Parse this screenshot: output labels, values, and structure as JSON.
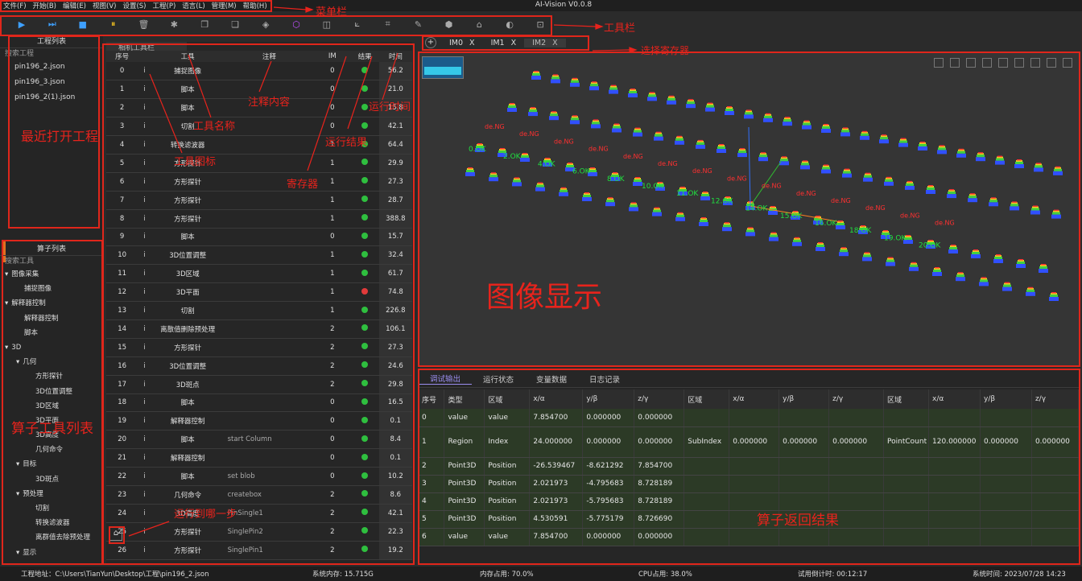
{
  "menu": {
    "items": [
      "文件(F)",
      "开始(B)",
      "编辑(E)",
      "视图(V)",
      "设置(S)",
      "工程(P)",
      "语言(L)",
      "管理(M)",
      "帮助(H)"
    ]
  },
  "app_title": "AI-Vision V0.0.8",
  "toolbar": {
    "icons": [
      {
        "name": "run-icon",
        "glyph": "▶",
        "tone": "blue"
      },
      {
        "name": "run-loop-icon",
        "glyph": "⏭",
        "tone": "blue"
      },
      {
        "name": "save-icon",
        "glyph": "■",
        "tone": "blue"
      },
      {
        "name": "pause-icon",
        "glyph": "⏸",
        "tone": "yellow"
      },
      {
        "name": "delete-icon",
        "glyph": "🗑",
        "tone": "gray"
      },
      {
        "name": "debug-icon",
        "glyph": "✱",
        "tone": "gray"
      },
      {
        "name": "copy-icon",
        "glyph": "❐",
        "tone": "gray"
      },
      {
        "name": "paste-icon",
        "glyph": "❏",
        "tone": "gray"
      },
      {
        "name": "cube-icon",
        "glyph": "◈",
        "tone": "gray"
      },
      {
        "name": "3d-view-icon",
        "glyph": "⬡",
        "tone": "purple"
      },
      {
        "name": "camera-icon",
        "glyph": "◫",
        "tone": "gray"
      },
      {
        "name": "measure-icon",
        "glyph": "⟀",
        "tone": "gray"
      },
      {
        "name": "crop-icon",
        "glyph": "⌗",
        "tone": "gray"
      },
      {
        "name": "brush-icon",
        "glyph": "✎",
        "tone": "gray"
      },
      {
        "name": "box-icon",
        "glyph": "⬢",
        "tone": "gray"
      },
      {
        "name": "home-icon",
        "glyph": "⌂",
        "tone": "gray"
      },
      {
        "name": "chart-icon",
        "glyph": "◐",
        "tone": "gray"
      },
      {
        "name": "focus-icon",
        "glyph": "⊡",
        "tone": "gray"
      }
    ]
  },
  "project_panel": {
    "title": "工程列表",
    "search": "搜索工程",
    "recent": [
      "pin196_2.json",
      "pin196_3.json",
      "pin196_2(1).json"
    ]
  },
  "algo_panel": {
    "title": "算子列表",
    "search": "搜索工具",
    "tree": [
      {
        "label": "图像采集",
        "level": 0,
        "arrow": "▾"
      },
      {
        "label": "捕捉图像",
        "level": 1,
        "arrow": ""
      },
      {
        "label": "解释器控制",
        "level": 0,
        "arrow": "▾"
      },
      {
        "label": "解释器控制",
        "level": 1,
        "arrow": ""
      },
      {
        "label": "脚本",
        "level": 1,
        "arrow": ""
      },
      {
        "label": "3D",
        "level": 0,
        "arrow": "▾"
      },
      {
        "label": "几何",
        "level": 1,
        "arrow": "▾"
      },
      {
        "label": "方形探针",
        "level": 2,
        "arrow": ""
      },
      {
        "label": "3D位置调整",
        "level": 2,
        "arrow": ""
      },
      {
        "label": "3D区域",
        "level": 2,
        "arrow": ""
      },
      {
        "label": "3D平面",
        "level": 2,
        "arrow": ""
      },
      {
        "label": "3D高度",
        "level": 2,
        "arrow": ""
      },
      {
        "label": "几何命令",
        "level": 2,
        "arrow": ""
      },
      {
        "label": "目标",
        "level": 1,
        "arrow": "▾"
      },
      {
        "label": "3D斑点",
        "level": 2,
        "arrow": ""
      },
      {
        "label": "预处理",
        "level": 1,
        "arrow": "▾"
      },
      {
        "label": "切割",
        "level": 2,
        "arrow": ""
      },
      {
        "label": "转换滤波器",
        "level": 2,
        "arrow": ""
      },
      {
        "label": "离群值去除预处理",
        "level": 2,
        "arrow": ""
      },
      {
        "label": "显示",
        "level": 1,
        "arrow": "▾"
      }
    ]
  },
  "tool_panel": {
    "tab": "相机工具栏",
    "headers": [
      "序号",
      "工具",
      "注释",
      "IM",
      "结果",
      "时间"
    ],
    "rows": [
      {
        "id": "0",
        "tool": "捕捉图像",
        "note": "",
        "im": "0",
        "result": "ok",
        "time": "56.2"
      },
      {
        "id": "1",
        "tool": "脚本",
        "note": "",
        "im": "0",
        "result": "ok",
        "time": "21.0"
      },
      {
        "id": "2",
        "tool": "脚本",
        "note": "",
        "im": "0",
        "result": "ok",
        "time": "15.8"
      },
      {
        "id": "3",
        "tool": "切割",
        "note": "",
        "im": "0",
        "result": "ok",
        "time": "42.1"
      },
      {
        "id": "4",
        "tool": "转换滤波器",
        "note": "",
        "im": "1",
        "result": "ok",
        "time": "64.4"
      },
      {
        "id": "5",
        "tool": "方形探针",
        "note": "",
        "im": "1",
        "result": "ok",
        "time": "29.9"
      },
      {
        "id": "6",
        "tool": "方形探针",
        "note": "",
        "im": "1",
        "result": "ok",
        "time": "27.3"
      },
      {
        "id": "7",
        "tool": "方形探针",
        "note": "",
        "im": "1",
        "result": "ok",
        "time": "28.7"
      },
      {
        "id": "8",
        "tool": "方形探针",
        "note": "",
        "im": "1",
        "result": "ok",
        "time": "388.8"
      },
      {
        "id": "9",
        "tool": "脚本",
        "note": "",
        "im": "0",
        "result": "ok",
        "time": "15.7"
      },
      {
        "id": "10",
        "tool": "3D位置调整",
        "note": "",
        "im": "1",
        "result": "ok",
        "time": "32.4"
      },
      {
        "id": "11",
        "tool": "3D区域",
        "note": "",
        "im": "1",
        "result": "ok",
        "time": "61.7"
      },
      {
        "id": "12",
        "tool": "3D平面",
        "note": "",
        "im": "1",
        "result": "ng",
        "time": "74.8"
      },
      {
        "id": "13",
        "tool": "切割",
        "note": "",
        "im": "1",
        "result": "ok",
        "time": "226.8"
      },
      {
        "id": "14",
        "tool": "离散值删除预处理",
        "note": "",
        "im": "2",
        "result": "ok",
        "time": "106.1"
      },
      {
        "id": "15",
        "tool": "方形探针",
        "note": "",
        "im": "2",
        "result": "ok",
        "time": "27.3"
      },
      {
        "id": "16",
        "tool": "3D位置调整",
        "note": "",
        "im": "2",
        "result": "ok",
        "time": "24.6"
      },
      {
        "id": "17",
        "tool": "3D斑点",
        "note": "",
        "im": "2",
        "result": "ok",
        "time": "29.8"
      },
      {
        "id": "18",
        "tool": "脚本",
        "note": "",
        "im": "0",
        "result": "ok",
        "time": "16.5"
      },
      {
        "id": "19",
        "tool": "解释器控制",
        "note": "",
        "im": "0",
        "result": "ok",
        "time": "0.1"
      },
      {
        "id": "20",
        "tool": "脚本",
        "note": "start Column",
        "im": "0",
        "result": "ok",
        "time": "8.4"
      },
      {
        "id": "21",
        "tool": "解释器控制",
        "note": "",
        "im": "0",
        "result": "ok",
        "time": "0.1"
      },
      {
        "id": "22",
        "tool": "脚本",
        "note": "set blob",
        "im": "0",
        "result": "ok",
        "time": "10.2"
      },
      {
        "id": "23",
        "tool": "几何命令",
        "note": "createbox",
        "im": "2",
        "result": "ok",
        "time": "8.6"
      },
      {
        "id": "24",
        "tool": "3D高度",
        "note": "PinSingle1",
        "im": "2",
        "result": "ok",
        "time": "42.1"
      },
      {
        "id": "25",
        "tool": "方形探针",
        "note": "SinglePin2",
        "im": "2",
        "result": "ok",
        "time": "22.3"
      },
      {
        "id": "26",
        "tool": "方形探针",
        "note": "SinglePin1",
        "im": "2",
        "result": "ok",
        "time": "19.2"
      }
    ]
  },
  "image_tabs": {
    "add": "+",
    "tabs": [
      {
        "label": "IM0",
        "close": "X"
      },
      {
        "label": "IM1",
        "close": "X"
      },
      {
        "label": "IM2",
        "close": "X"
      }
    ]
  },
  "viewer": {
    "view_icons": [
      "perspective-icon",
      "wire-icon",
      "grid-icon",
      "front-view-icon",
      "back-view-icon",
      "left-view-icon",
      "right-view-icon",
      "top-view-icon",
      "bottom-view-icon"
    ],
    "ok_labels": [
      "0.OK",
      "2.OK",
      "4.OK",
      "6.OK",
      "8.OK",
      "10.OK",
      "11.OK",
      "12.OK",
      "14.OK",
      "15.OK",
      "16.OK",
      "18.OK",
      "19.OK",
      "20.OK"
    ],
    "ng_label": "de.NG"
  },
  "result_panel": {
    "tabs": [
      "调试输出",
      "运行状态",
      "变量数据",
      "日志记录"
    ],
    "headers": [
      "序号",
      "类型",
      "区域",
      "x/α",
      "y/β",
      "z/γ",
      "区域",
      "x/α",
      "y/β",
      "z/γ",
      "区域",
      "x/α",
      "y/β",
      "z/γ"
    ],
    "rows": [
      [
        "0",
        "value",
        "value",
        "7.854700",
        "0.000000",
        "0.000000",
        "",
        "",
        "",
        "",
        "",
        "",
        "",
        ""
      ],
      [
        "1",
        "Region",
        "Index",
        "24.000000",
        "0.000000",
        "0.000000",
        "SubIndex",
        "0.000000",
        "0.000000",
        "0.000000",
        "PointCount",
        "120.000000",
        "0.000000",
        "0.000000"
      ],
      [
        "2",
        "Point3D",
        "Position",
        "-26.539467",
        "-8.621292",
        "7.854700",
        "",
        "",
        "",
        "",
        "",
        "",
        "",
        ""
      ],
      [
        "3",
        "Point3D",
        "Position",
        "2.021973",
        "-4.795683",
        "8.728189",
        "",
        "",
        "",
        "",
        "",
        "",
        "",
        ""
      ],
      [
        "4",
        "Point3D",
        "Position",
        "2.021973",
        "-5.795683",
        "8.728189",
        "",
        "",
        "",
        "",
        "",
        "",
        "",
        ""
      ],
      [
        "5",
        "Point3D",
        "Position",
        "4.530591",
        "-5.775179",
        "8.726690",
        "",
        "",
        "",
        "",
        "",
        "",
        "",
        ""
      ],
      [
        "6",
        "value",
        "value",
        "7.854700",
        "0.000000",
        "0.000000",
        "",
        "",
        "",
        "",
        "",
        "",
        "",
        ""
      ]
    ]
  },
  "status": {
    "path": "工程地址：C:\\Users\\TianYun\\Desktop\\工程\\pin196_2.json",
    "sysmem": "系统内存: 15.715G",
    "memuse": "内存占用: 70.0%",
    "cpu": "CPU占用: 38.0%",
    "trial": "试用倒计时: 00:12:17",
    "systime": "系统时间: 2023/07/28 14:23"
  },
  "annotations": {
    "menubar": "菜单栏",
    "toolbar": "工具栏",
    "select_register": "选择寄存器",
    "recent_projects": "最近打开工程",
    "tool_name": "工具名称",
    "tool_icon": "工具图标",
    "note_content": "注释内容",
    "run_time": "运行时间",
    "run_result": "运行结果",
    "register": "寄存器",
    "image_display": "图像显示",
    "algo_list": "算子工具列表",
    "run_step": "运行到哪一步",
    "algo_result": "算子返回结果"
  },
  "colors": {
    "accent": "#9b8ef0",
    "annotation": "#e8231c",
    "ok": "#2fbf3f",
    "ng": "#e13a3a"
  }
}
